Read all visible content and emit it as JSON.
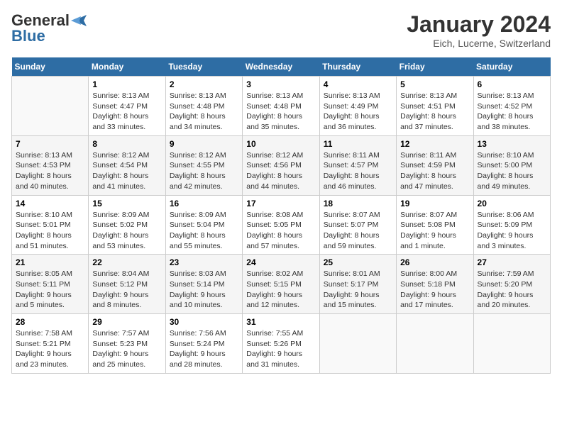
{
  "logo": {
    "line1": "General",
    "line2": "Blue"
  },
  "title": "January 2024",
  "subtitle": "Eich, Lucerne, Switzerland",
  "days_of_week": [
    "Sunday",
    "Monday",
    "Tuesday",
    "Wednesday",
    "Thursday",
    "Friday",
    "Saturday"
  ],
  "weeks": [
    [
      {
        "num": "",
        "info": ""
      },
      {
        "num": "1",
        "info": "Sunrise: 8:13 AM\nSunset: 4:47 PM\nDaylight: 8 hours\nand 33 minutes."
      },
      {
        "num": "2",
        "info": "Sunrise: 8:13 AM\nSunset: 4:48 PM\nDaylight: 8 hours\nand 34 minutes."
      },
      {
        "num": "3",
        "info": "Sunrise: 8:13 AM\nSunset: 4:48 PM\nDaylight: 8 hours\nand 35 minutes."
      },
      {
        "num": "4",
        "info": "Sunrise: 8:13 AM\nSunset: 4:49 PM\nDaylight: 8 hours\nand 36 minutes."
      },
      {
        "num": "5",
        "info": "Sunrise: 8:13 AM\nSunset: 4:51 PM\nDaylight: 8 hours\nand 37 minutes."
      },
      {
        "num": "6",
        "info": "Sunrise: 8:13 AM\nSunset: 4:52 PM\nDaylight: 8 hours\nand 38 minutes."
      }
    ],
    [
      {
        "num": "7",
        "info": "Sunrise: 8:13 AM\nSunset: 4:53 PM\nDaylight: 8 hours\nand 40 minutes."
      },
      {
        "num": "8",
        "info": "Sunrise: 8:12 AM\nSunset: 4:54 PM\nDaylight: 8 hours\nand 41 minutes."
      },
      {
        "num": "9",
        "info": "Sunrise: 8:12 AM\nSunset: 4:55 PM\nDaylight: 8 hours\nand 42 minutes."
      },
      {
        "num": "10",
        "info": "Sunrise: 8:12 AM\nSunset: 4:56 PM\nDaylight: 8 hours\nand 44 minutes."
      },
      {
        "num": "11",
        "info": "Sunrise: 8:11 AM\nSunset: 4:57 PM\nDaylight: 8 hours\nand 46 minutes."
      },
      {
        "num": "12",
        "info": "Sunrise: 8:11 AM\nSunset: 4:59 PM\nDaylight: 8 hours\nand 47 minutes."
      },
      {
        "num": "13",
        "info": "Sunrise: 8:10 AM\nSunset: 5:00 PM\nDaylight: 8 hours\nand 49 minutes."
      }
    ],
    [
      {
        "num": "14",
        "info": "Sunrise: 8:10 AM\nSunset: 5:01 PM\nDaylight: 8 hours\nand 51 minutes."
      },
      {
        "num": "15",
        "info": "Sunrise: 8:09 AM\nSunset: 5:02 PM\nDaylight: 8 hours\nand 53 minutes."
      },
      {
        "num": "16",
        "info": "Sunrise: 8:09 AM\nSunset: 5:04 PM\nDaylight: 8 hours\nand 55 minutes."
      },
      {
        "num": "17",
        "info": "Sunrise: 8:08 AM\nSunset: 5:05 PM\nDaylight: 8 hours\nand 57 minutes."
      },
      {
        "num": "18",
        "info": "Sunrise: 8:07 AM\nSunset: 5:07 PM\nDaylight: 8 hours\nand 59 minutes."
      },
      {
        "num": "19",
        "info": "Sunrise: 8:07 AM\nSunset: 5:08 PM\nDaylight: 9 hours\nand 1 minute."
      },
      {
        "num": "20",
        "info": "Sunrise: 8:06 AM\nSunset: 5:09 PM\nDaylight: 9 hours\nand 3 minutes."
      }
    ],
    [
      {
        "num": "21",
        "info": "Sunrise: 8:05 AM\nSunset: 5:11 PM\nDaylight: 9 hours\nand 5 minutes."
      },
      {
        "num": "22",
        "info": "Sunrise: 8:04 AM\nSunset: 5:12 PM\nDaylight: 9 hours\nand 8 minutes."
      },
      {
        "num": "23",
        "info": "Sunrise: 8:03 AM\nSunset: 5:14 PM\nDaylight: 9 hours\nand 10 minutes."
      },
      {
        "num": "24",
        "info": "Sunrise: 8:02 AM\nSunset: 5:15 PM\nDaylight: 9 hours\nand 12 minutes."
      },
      {
        "num": "25",
        "info": "Sunrise: 8:01 AM\nSunset: 5:17 PM\nDaylight: 9 hours\nand 15 minutes."
      },
      {
        "num": "26",
        "info": "Sunrise: 8:00 AM\nSunset: 5:18 PM\nDaylight: 9 hours\nand 17 minutes."
      },
      {
        "num": "27",
        "info": "Sunrise: 7:59 AM\nSunset: 5:20 PM\nDaylight: 9 hours\nand 20 minutes."
      }
    ],
    [
      {
        "num": "28",
        "info": "Sunrise: 7:58 AM\nSunset: 5:21 PM\nDaylight: 9 hours\nand 23 minutes."
      },
      {
        "num": "29",
        "info": "Sunrise: 7:57 AM\nSunset: 5:23 PM\nDaylight: 9 hours\nand 25 minutes."
      },
      {
        "num": "30",
        "info": "Sunrise: 7:56 AM\nSunset: 5:24 PM\nDaylight: 9 hours\nand 28 minutes."
      },
      {
        "num": "31",
        "info": "Sunrise: 7:55 AM\nSunset: 5:26 PM\nDaylight: 9 hours\nand 31 minutes."
      },
      {
        "num": "",
        "info": ""
      },
      {
        "num": "",
        "info": ""
      },
      {
        "num": "",
        "info": ""
      }
    ]
  ]
}
